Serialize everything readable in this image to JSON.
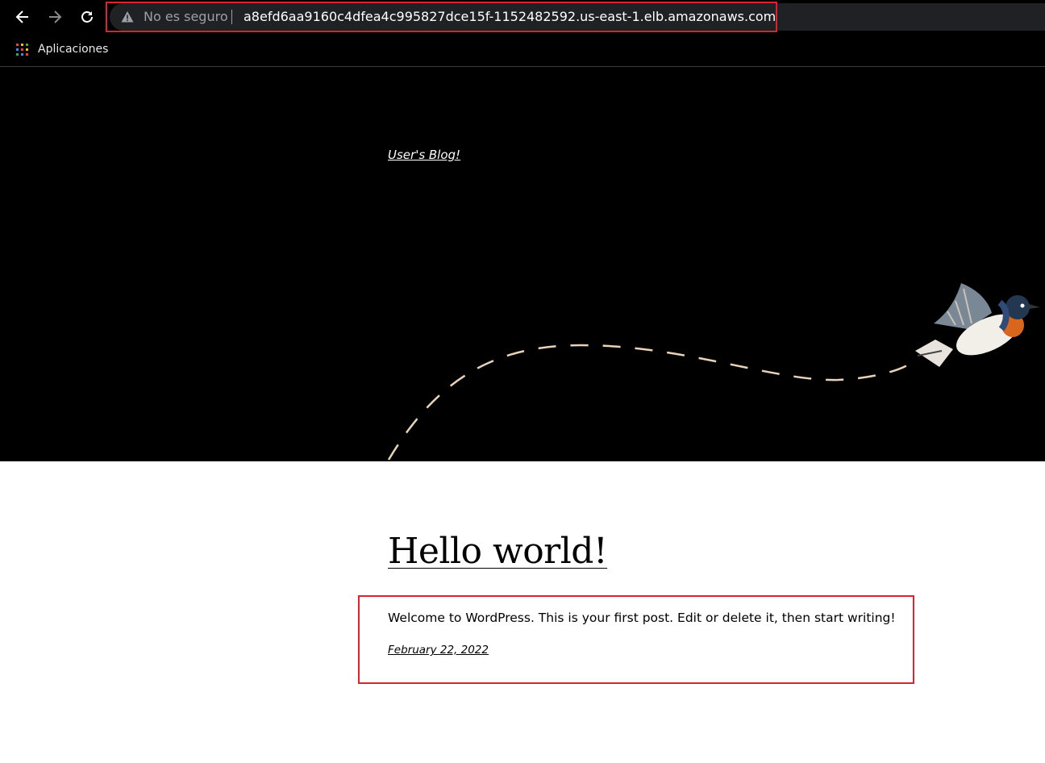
{
  "browser": {
    "nav": {
      "back_icon": "arrow-left-icon",
      "forward_icon": "arrow-right-icon",
      "reload_icon": "reload-icon"
    },
    "omnibox": {
      "security_icon": "warning-triangle-icon",
      "security_text": "No es seguro",
      "url": "a8efd6aa9160c4dfea4c995827dce15f-1152482592.us-east-1.elb.amazonaws.com"
    },
    "bookmarks": {
      "apps_icon": "apps-grid-icon",
      "apps_label": "Aplicaciones"
    }
  },
  "site": {
    "title": "User's Blog!",
    "hero_illustration": "bird-flight-path-illustration"
  },
  "post": {
    "title": "Hello world!",
    "excerpt": "Welcome to WordPress. This is your first post. Edit or delete it, then start writing!",
    "date": "February 22, 2022"
  },
  "colors": {
    "highlight": "#d9232e",
    "hero_bg": "#000000",
    "dash_path": "#e9d3b8"
  }
}
